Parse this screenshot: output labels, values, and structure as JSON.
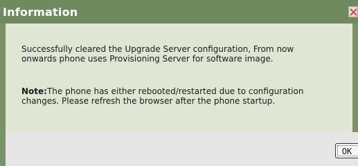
{
  "dialog": {
    "title": "Information",
    "close_icon": "close-x-icon",
    "message": "Successfully cleared the Upgrade Server configuration, From now onwards phone uses Provisioning Server for software image.",
    "note_label": "Note:",
    "note_text": "The phone has either rebooted/restarted due to configuration changes. Please refresh the browser after the phone startup.",
    "ok_label": "OK"
  },
  "colors": {
    "titlebar": "#6f8a5f",
    "content_bg": "#dfe6d4",
    "footer_bg": "#e6e6e6",
    "border": "#7b9168",
    "close_icon": "#c0504d"
  }
}
